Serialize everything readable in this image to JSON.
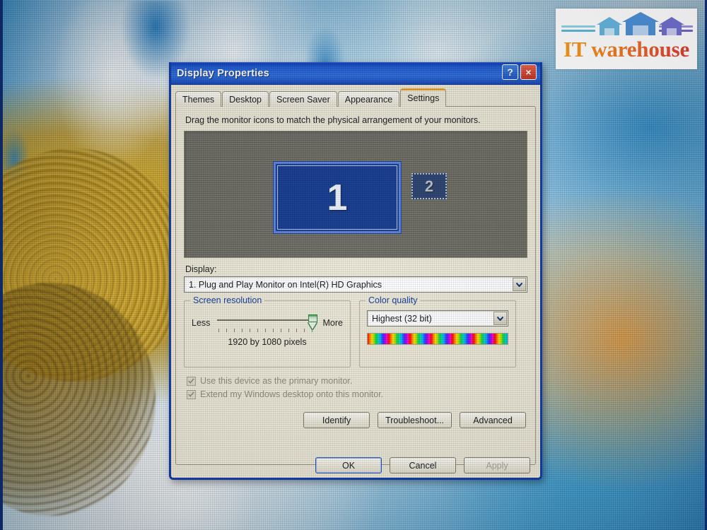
{
  "logo": {
    "text": "IT warehouse",
    "accent_orange": "#f09b1f",
    "accent_red": "#dd3a32",
    "houses": [
      {
        "name": "house-light-blue",
        "color": "#64b4df"
      },
      {
        "name": "house-blue",
        "color": "#4b8fd6"
      },
      {
        "name": "house-purple",
        "color": "#6f6fd0"
      }
    ],
    "line_left_color": "#7fc8de",
    "line_right_color": "#7a6fc4"
  },
  "dialog": {
    "title": "Display Properties",
    "titlebar_buttons": [
      {
        "name": "help-button",
        "glyph": "?"
      },
      {
        "name": "close-button",
        "glyph": "×"
      }
    ],
    "tabs": [
      {
        "label": "Themes",
        "active": false
      },
      {
        "label": "Desktop",
        "active": false
      },
      {
        "label": "Screen Saver",
        "active": false
      },
      {
        "label": "Appearance",
        "active": false
      },
      {
        "label": "Settings",
        "active": true
      }
    ],
    "settings": {
      "hint": "Drag the monitor icons to match the physical arrangement of your monitors.",
      "monitors": [
        {
          "number": "1",
          "selected": true
        },
        {
          "number": "2",
          "selected": false
        }
      ],
      "display_label": "Display:",
      "display_value": "1. Plug and Play Monitor on Intel(R) HD Graphics",
      "screen_resolution": {
        "legend": "Screen resolution",
        "less_label": "Less",
        "more_label": "More",
        "value_text": "1920 by 1080 pixels",
        "slider_position_percent": 100
      },
      "color_quality": {
        "legend": "Color quality",
        "value": "Highest (32 bit)"
      },
      "checkboxes": [
        {
          "label": "Use this device as the primary monitor.",
          "checked": true,
          "disabled": true
        },
        {
          "label": "Extend my Windows desktop onto this monitor.",
          "checked": true,
          "disabled": true
        }
      ],
      "action_buttons": [
        {
          "label": "Identify",
          "disabled": false
        },
        {
          "label": "Troubleshoot...",
          "disabled": false
        },
        {
          "label": "Advanced",
          "disabled": false
        }
      ]
    },
    "footer_buttons": [
      {
        "label": "OK",
        "default": true,
        "disabled": false
      },
      {
        "label": "Cancel",
        "default": false,
        "disabled": false
      },
      {
        "label": "Apply",
        "default": false,
        "disabled": true
      }
    ]
  }
}
